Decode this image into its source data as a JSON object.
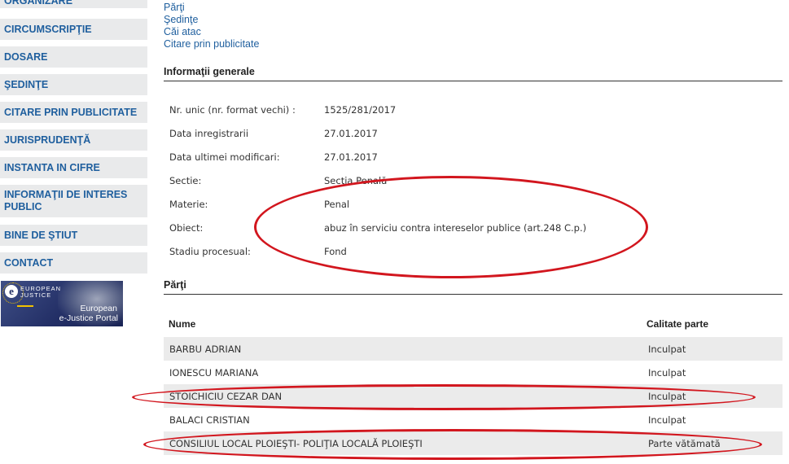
{
  "sidebar": {
    "items": [
      {
        "label": "ORGANIZARE"
      },
      {
        "label": "CIRCUMSCRIPŢIE"
      },
      {
        "label": "DOSARE"
      },
      {
        "label": "ŞEDINŢE"
      },
      {
        "label": "CITARE PRIN PUBLICITATE"
      },
      {
        "label": "JURISPRUDENŢĂ"
      },
      {
        "label": "INSTANTA IN CIFRE"
      },
      {
        "label": "INFORMAŢII DE INTERES PUBLIC"
      },
      {
        "label": "BINE DE ŞTIUT"
      },
      {
        "label": "CONTACT"
      }
    ],
    "banner": {
      "top_line1": "EUROPEAN",
      "top_line2": "JUSTICE",
      "bottom_line1": "European",
      "bottom_line2": "e-Justice Portal"
    }
  },
  "top_links": [
    "Părţi",
    "Şedinţe",
    "Căi atac",
    "Citare prin publicitate"
  ],
  "general_info": {
    "title": "Informaţii generale",
    "rows": [
      {
        "label": "Nr. unic (nr. format vechi) :",
        "value": "1525/281/2017"
      },
      {
        "label": "Data inregistrarii",
        "value": "27.01.2017"
      },
      {
        "label": "Data ultimei modificari:",
        "value": "27.01.2017"
      },
      {
        "label": "Sectie:",
        "value": "Secţia Penală"
      },
      {
        "label": "Materie:",
        "value": "Penal"
      },
      {
        "label": "Obiect:",
        "value": "abuz în serviciu contra intereselor publice (art.248 C.p.)"
      },
      {
        "label": "Stadiu procesual:",
        "value": "Fond"
      }
    ]
  },
  "parties": {
    "title": "Părţi",
    "col_name": "Nume",
    "col_role": "Calitate parte",
    "rows": [
      {
        "name": "BARBU ADRIAN",
        "role": "Inculpat"
      },
      {
        "name": "IONESCU MARIANA",
        "role": "Inculpat"
      },
      {
        "name": "STOICHICIU CEZAR DAN",
        "role": "Inculpat"
      },
      {
        "name": "BALACI CRISTIAN",
        "role": "Inculpat"
      },
      {
        "name": "CONSILIUL LOCAL PLOIEŞTI- POLIŢIA LOCALĂ PLOIEŞTI",
        "role": "Parte vătămată"
      }
    ]
  },
  "annotation_color": "#d2161e"
}
